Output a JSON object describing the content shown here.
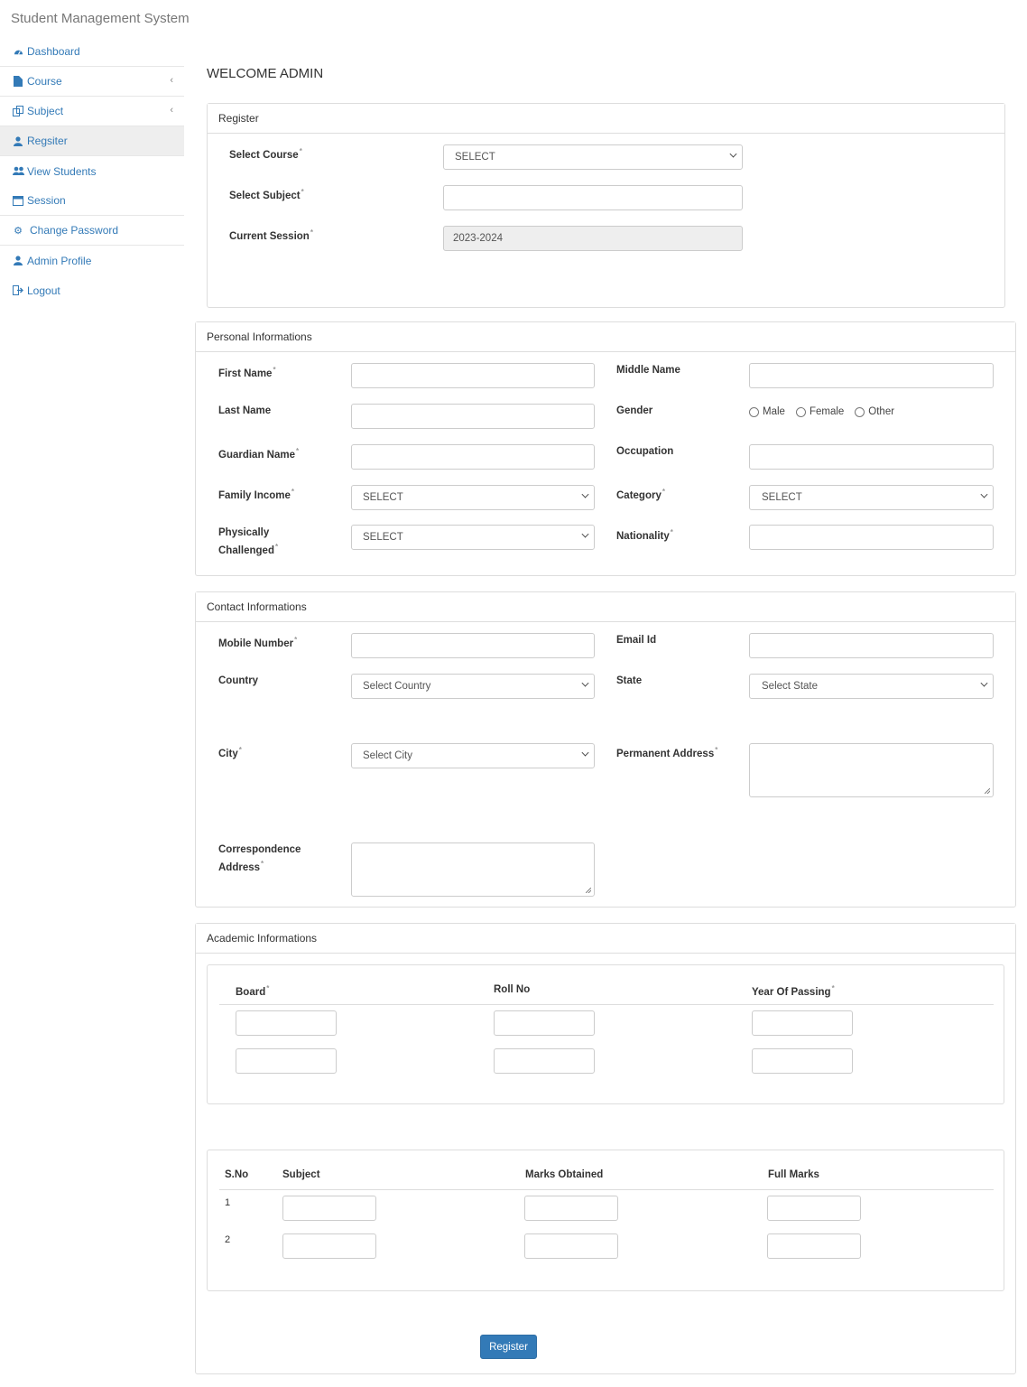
{
  "app": {
    "title": "Student Management System"
  },
  "sidebar": {
    "items": [
      {
        "label": "Dashboard",
        "icon": "dashboard-icon"
      },
      {
        "label": "Course",
        "icon": "file-icon"
      },
      {
        "label": "Subject",
        "icon": "copy-icon"
      },
      {
        "label": "Regsiter",
        "icon": "user-icon"
      },
      {
        "label": "View Students",
        "icon": "users-icon"
      },
      {
        "label": "Session",
        "icon": "calendar-icon"
      },
      {
        "label": "Change Password",
        "icon": "gear-icon"
      },
      {
        "label": "Admin Profile",
        "icon": "user-icon"
      },
      {
        "label": "Logout",
        "icon": "logout-icon"
      }
    ]
  },
  "page": {
    "welcome": "WELCOME ADMIN"
  },
  "register": {
    "heading": "Register",
    "course_label": "Select Course",
    "course_value": "SELECT",
    "subject_label": "Select Subject",
    "session_label": "Current Session",
    "session_value": "2023-2024"
  },
  "personal": {
    "heading": "Personal Informations",
    "first_name": "First Name",
    "middle_name": "Middle Name",
    "last_name": "Last Name",
    "gender": "Gender",
    "gender_options": [
      "Male",
      "Female",
      "Other"
    ],
    "guardian_name": "Guardian Name",
    "occupation": "Occupation",
    "family_income": "Family Income",
    "family_income_value": "SELECT",
    "category": "Category",
    "category_value": "SELECT",
    "physically_1": "Physically",
    "physically_2": "Challenged",
    "physically_value": "SELECT",
    "nationality": "Nationality"
  },
  "contact": {
    "heading": "Contact Informations",
    "mobile": "Mobile Number",
    "email": "Email Id",
    "country": "Country",
    "country_value": "Select Country",
    "state": "State",
    "state_value": "Select State",
    "city": "City",
    "city_value": "Select City",
    "permanent": "Permanent Address",
    "corr_1": "Correspondence",
    "corr_2": "Address"
  },
  "academic": {
    "heading": "Academic Informations",
    "board_cols": [
      "Board",
      "Roll No",
      "Year Of Passing"
    ],
    "marks_cols": [
      "S.No",
      "Subject",
      "Marks Obtained",
      "Full Marks"
    ],
    "rows": [
      "1",
      "2"
    ],
    "submit": "Register"
  }
}
